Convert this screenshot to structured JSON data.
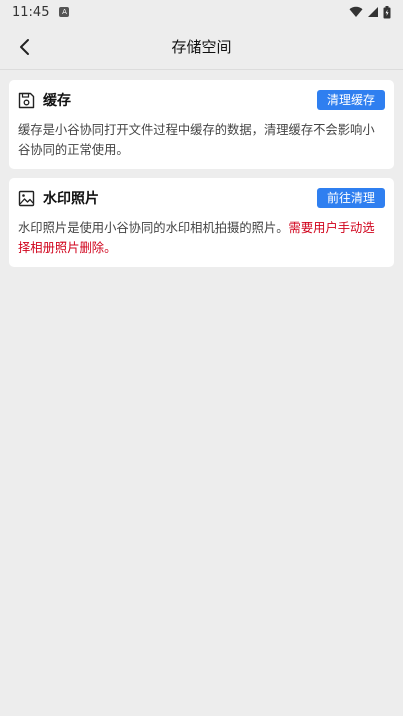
{
  "status_bar": {
    "time": "11:45",
    "notif_letter": "A"
  },
  "header": {
    "title": "存储空间"
  },
  "cards": [
    {
      "icon": "save-disk-icon",
      "title": "缓存",
      "button_label": "清理缓存",
      "description": "缓存是小谷协同打开文件过程中缓存的数据，清理缓存不会影响小谷协同的正常使用。"
    },
    {
      "icon": "image-icon",
      "title": "水印照片",
      "button_label": "前往清理",
      "description": "水印照片是使用小谷协同的水印相机拍摄的照片。",
      "warning": "需要用户手动选择相册照片删除。"
    }
  ],
  "colors": {
    "accent": "#2F7FF0",
    "warning": "#D0021B",
    "background": "#EDEDED"
  }
}
